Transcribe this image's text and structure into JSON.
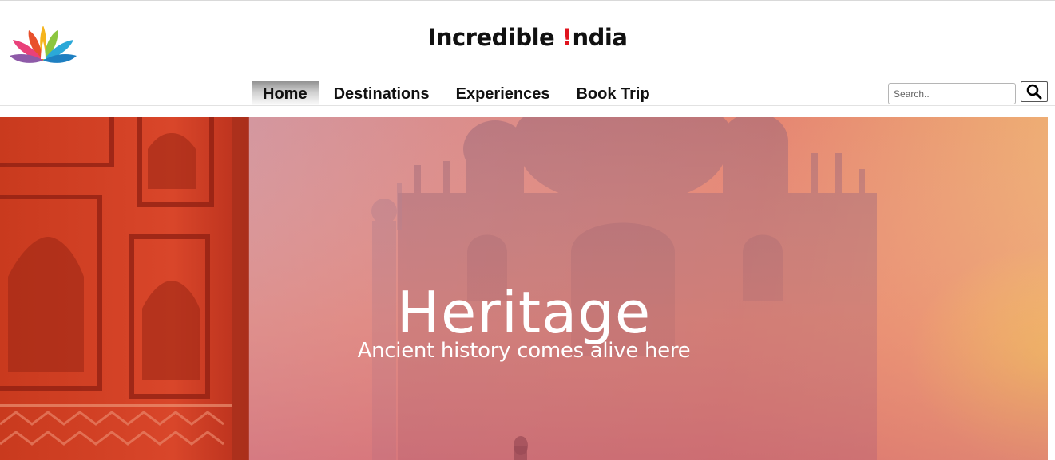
{
  "header": {
    "brand_prefix": "Incredible ",
    "brand_bang": "!",
    "brand_suffix": "ndia",
    "logo_icon": "lotus-logo-icon"
  },
  "nav": {
    "items": [
      {
        "label": "Home",
        "active": true
      },
      {
        "label": "Destinations",
        "active": false
      },
      {
        "label": "Experiences",
        "active": false
      },
      {
        "label": "Book Trip",
        "active": false
      }
    ]
  },
  "search": {
    "placeholder": "Search..",
    "value": "",
    "button_icon": "search-icon"
  },
  "hero": {
    "title": "Heritage",
    "subtitle": "Ancient history comes alive here"
  },
  "colors": {
    "brand_accent": "#e0141e",
    "active_tab_gradient_top": "#8d8d8d"
  }
}
